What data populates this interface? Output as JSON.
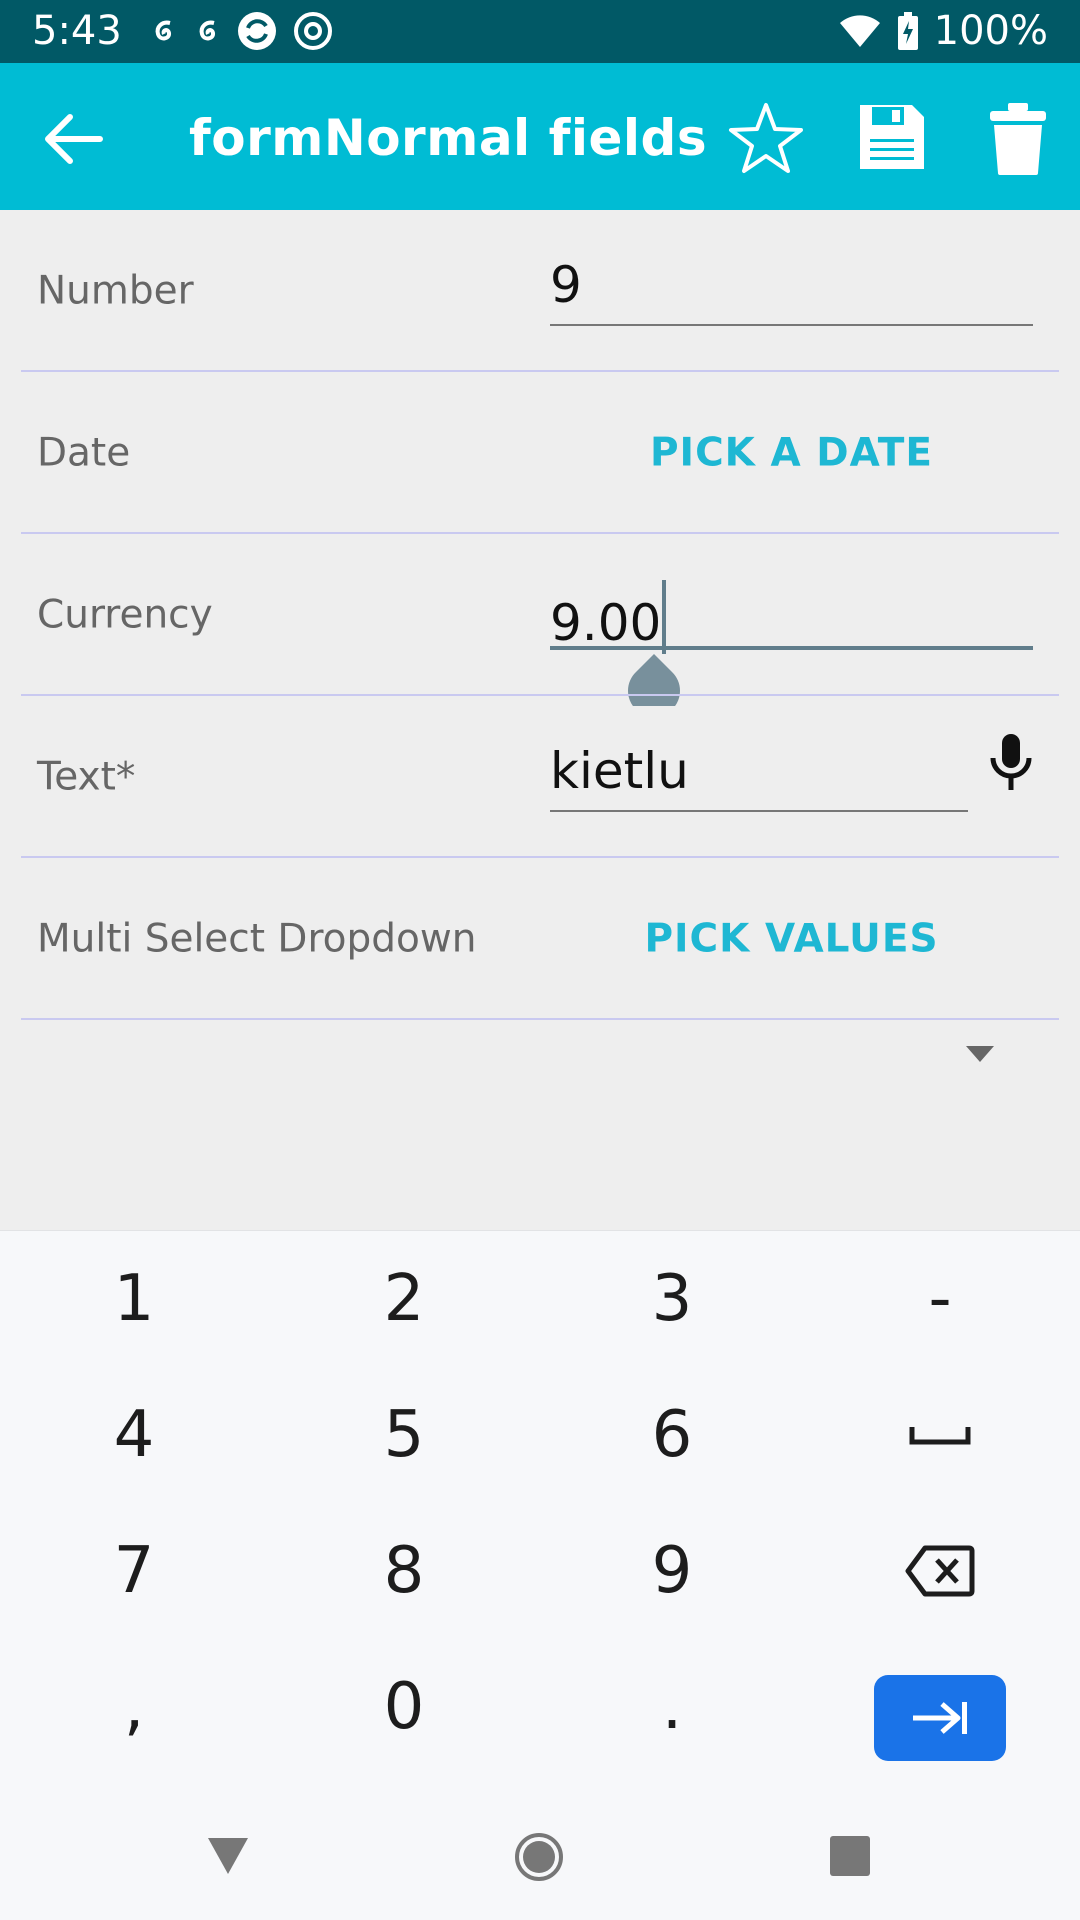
{
  "status_bar": {
    "time": "5:43",
    "battery": "100%",
    "left_icons": [
      "notification-icon",
      "notification-icon",
      "sync-icon",
      "at-sign-icon"
    ],
    "right_icons": [
      "wifi-icon",
      "battery-charging-icon"
    ]
  },
  "app_bar": {
    "title": "formNormal fields",
    "background": "#00bcd4",
    "actions": [
      "star-icon",
      "save-icon",
      "delete-icon"
    ]
  },
  "form": {
    "fields": [
      {
        "label": "Number",
        "type": "number",
        "value": "9"
      },
      {
        "label": "Date",
        "type": "date",
        "button": "PICK A DATE"
      },
      {
        "label": "Currency",
        "type": "currency",
        "value": "9.00",
        "focused": true
      },
      {
        "label": "Text*",
        "type": "text",
        "value": "kietlu",
        "icon": "microphone-icon"
      },
      {
        "label": "Multi Select Dropdown",
        "type": "multi-select",
        "button": "PICK VALUES"
      }
    ],
    "accent": "#1eb7d3"
  },
  "keyboard": {
    "rows": [
      [
        "1",
        "2",
        "3",
        "-"
      ],
      [
        "4",
        "5",
        "6",
        "space-icon"
      ],
      [
        "7",
        "8",
        "9",
        "backspace-icon"
      ],
      [
        ",",
        "0",
        ".",
        "tab-next-icon"
      ]
    ],
    "action_color": "#1a73e8"
  },
  "nav_bar": {
    "buttons": [
      "nav-back-icon",
      "nav-home-icon",
      "nav-recents-icon"
    ]
  }
}
